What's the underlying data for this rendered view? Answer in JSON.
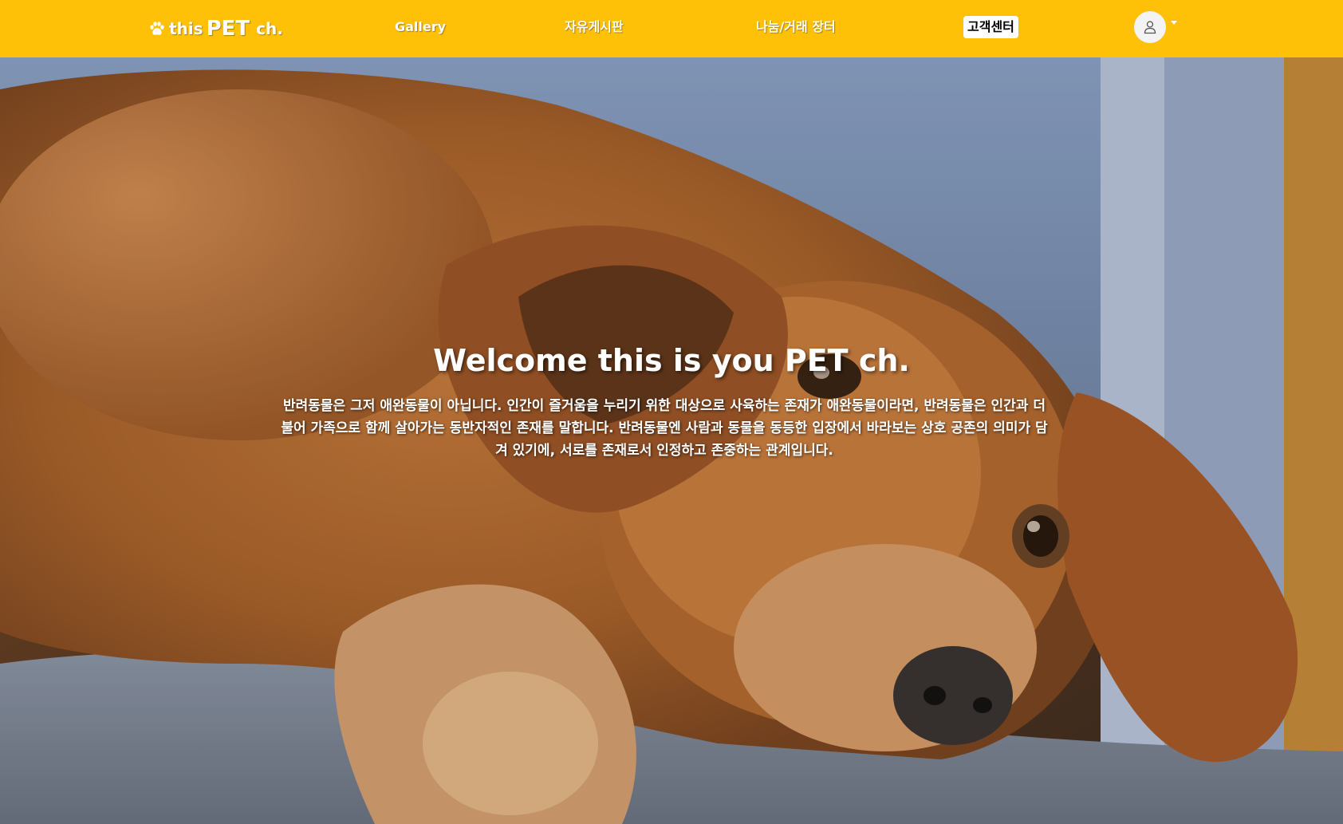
{
  "nav": {
    "brand": {
      "part1": "this",
      "part2": "PET",
      "part3": "ch."
    },
    "links": {
      "gallery": "Gallery",
      "free_board": "자유게시판",
      "market": "나눔/거래 장터",
      "support": "고객센터"
    },
    "user_icon": "user-icon",
    "dropdown_icon": "caret-down-icon",
    "brand_icon": "paw-icon"
  },
  "hero": {
    "title": "Welcome this is you PET ch.",
    "text": "반려동물은 그저 애완동물이 아닙니다. 인간이 즐거움을 누리기 위한 대상으로 사육하는 존재가 애완동물이라면, 반려동물은 인간과 더불어 가족으로 함께 살아가는 동반자적인 존재를 말합니다. 반려동물엔 사람과 동물을 동등한 입장에서 바라보는 상호 공존의 의미가 담겨 있기에, 서로를 존재로서 인정하고 존중하는 관계입니다."
  },
  "colors": {
    "navbar": "#ffc107",
    "text": "#ffffff"
  }
}
